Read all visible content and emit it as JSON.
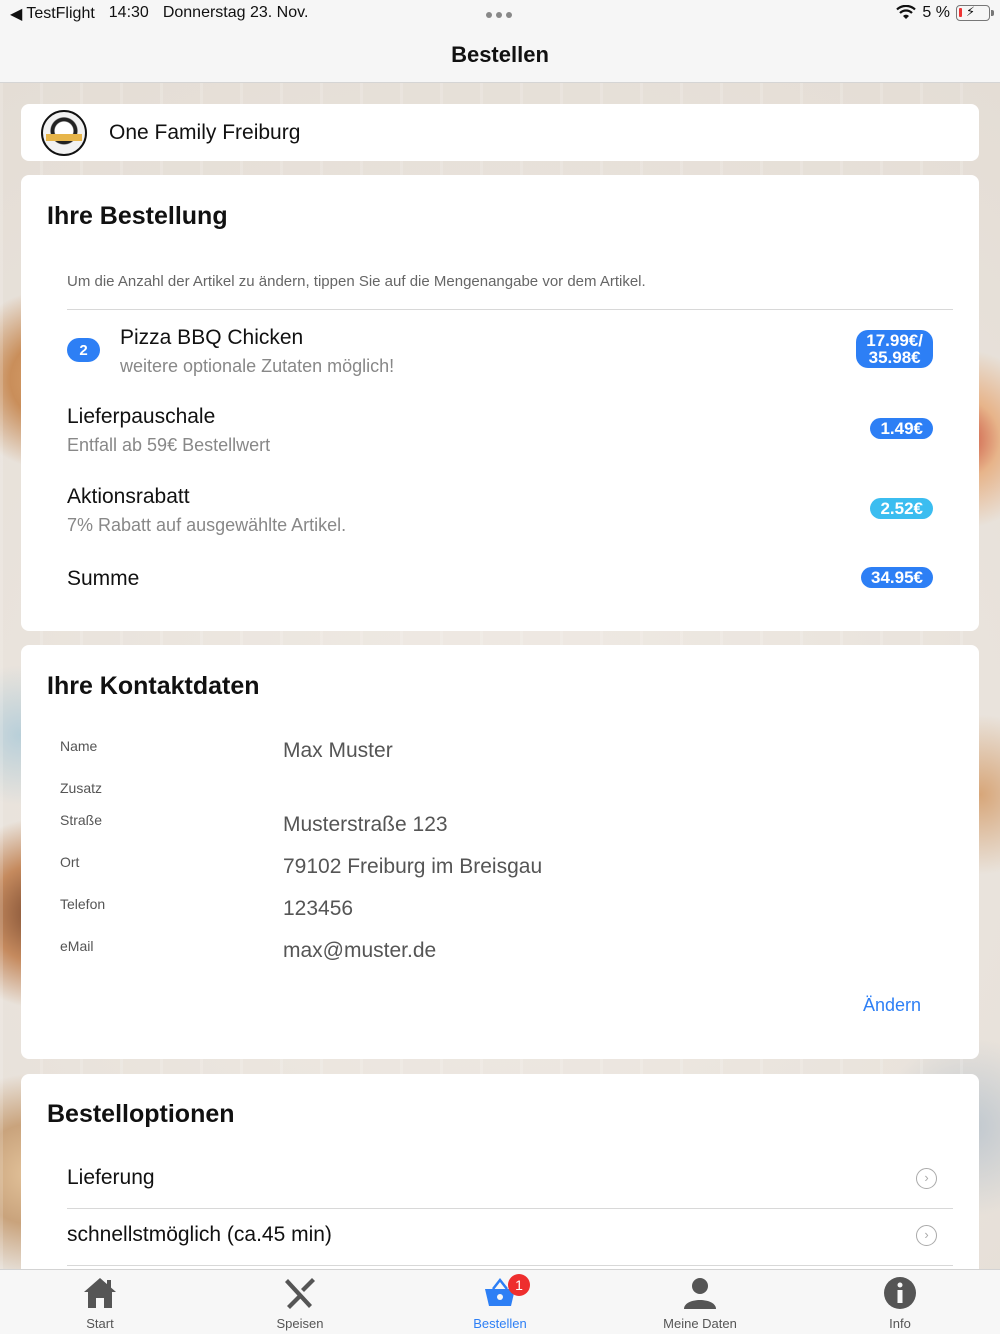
{
  "status_bar": {
    "back_app": "TestFlight",
    "time": "14:30",
    "date": "Donnerstag 23. Nov.",
    "battery": "5 %"
  },
  "nav": {
    "title": "Bestellen"
  },
  "restaurant": {
    "name": "One Family Freiburg"
  },
  "order": {
    "title": "Ihre Bestellung",
    "hint": "Um die Anzahl der Artikel zu ändern, tippen Sie auf die Mengenangabe vor dem Artikel.",
    "items": [
      {
        "qty": "2",
        "name": "Pizza BBQ Chicken",
        "sub": "weitere optionale Zutaten möglich!",
        "price_line1": "17.99€/",
        "price_line2": "35.98€"
      }
    ],
    "delivery": {
      "name": "Lieferpauschale",
      "sub": "Entfall ab 59€ Bestellwert",
      "price": "1.49€"
    },
    "discount": {
      "name": "Aktionsrabatt",
      "sub": "7% Rabatt auf ausgewählte Artikel.",
      "price": "2.52€"
    },
    "total": {
      "name": "Summe",
      "price": "34.95€"
    }
  },
  "contact": {
    "title": "Ihre Kontaktdaten",
    "rows": [
      {
        "label": "Name",
        "value": "Max Muster"
      },
      {
        "label": "Zusatz",
        "value": ""
      },
      {
        "label": "Straße",
        "value": "Musterstraße 123"
      },
      {
        "label": "Ort",
        "value": "79102 Freiburg im Breisgau"
      },
      {
        "label": "Telefon",
        "value": "123456"
      },
      {
        "label": "eMail",
        "value": "max@muster.de"
      }
    ],
    "edit_label": "Ändern"
  },
  "options": {
    "title": "Bestelloptionen",
    "rows": [
      {
        "label": "Lieferung"
      },
      {
        "label": "schnellstmöglich (ca.45 min)"
      }
    ]
  },
  "tabs": [
    {
      "label": "Start",
      "icon": "home-icon"
    },
    {
      "label": "Speisen",
      "icon": "cutlery-icon"
    },
    {
      "label": "Bestellen",
      "icon": "basket-icon",
      "badge": "1",
      "active": true
    },
    {
      "label": "Meine Daten",
      "icon": "person-icon"
    },
    {
      "label": "Info",
      "icon": "info-icon"
    }
  ],
  "colors": {
    "accent": "#2d7ff5",
    "discount": "#3bbdf0",
    "badge": "#ee2e2e"
  }
}
